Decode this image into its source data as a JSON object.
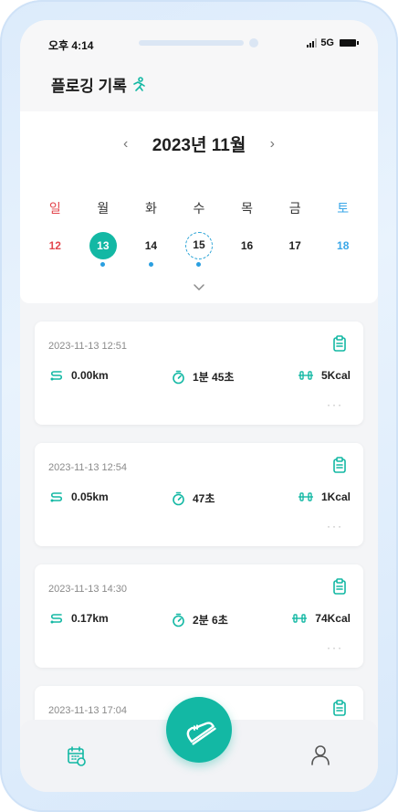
{
  "status_bar": {
    "time": "오후 4:14",
    "network": "5G"
  },
  "header": {
    "title": "플로깅 기록"
  },
  "calendar": {
    "month_label": "2023년 11월",
    "prev_icon": "chevron-left-icon",
    "next_icon": "chevron-right-icon",
    "weekdays": [
      "일",
      "월",
      "화",
      "수",
      "목",
      "금",
      "토"
    ],
    "dates": [
      {
        "day": "12",
        "type": "sun",
        "has_record": false
      },
      {
        "day": "13",
        "type": "selected",
        "has_record": true
      },
      {
        "day": "14",
        "type": "normal",
        "has_record": true
      },
      {
        "day": "15",
        "type": "today",
        "has_record": true
      },
      {
        "day": "16",
        "type": "normal",
        "has_record": false
      },
      {
        "day": "17",
        "type": "normal",
        "has_record": false
      },
      {
        "day": "18",
        "type": "sat",
        "has_record": false
      }
    ],
    "colors": {
      "sunday": "#e3474e",
      "saturday": "#3aa7e8",
      "accent": "#13b8a4",
      "dot": "#2a9fe0"
    }
  },
  "records": [
    {
      "datetime": "2023-11-13 12:51",
      "distance": "0.00km",
      "duration": "1분 45초",
      "calories": "5Kcal"
    },
    {
      "datetime": "2023-11-13 12:54",
      "distance": "0.05km",
      "duration": "47초",
      "calories": "1Kcal"
    },
    {
      "datetime": "2023-11-13 14:30",
      "distance": "0.17km",
      "duration": "2분 6초",
      "calories": "74Kcal"
    },
    {
      "datetime": "2023-11-13 17:04",
      "distance": "",
      "duration": "",
      "calories": ""
    }
  ],
  "icons": {
    "record_detail": "clipboard-icon",
    "distance": "route-icon",
    "duration": "stopwatch-icon",
    "calories": "dumbbell-icon",
    "more": "more-dots-icon",
    "fab": "sneaker-icon",
    "nav_left": "calendar-icon",
    "nav_right": "profile-icon"
  },
  "more_label": "···"
}
